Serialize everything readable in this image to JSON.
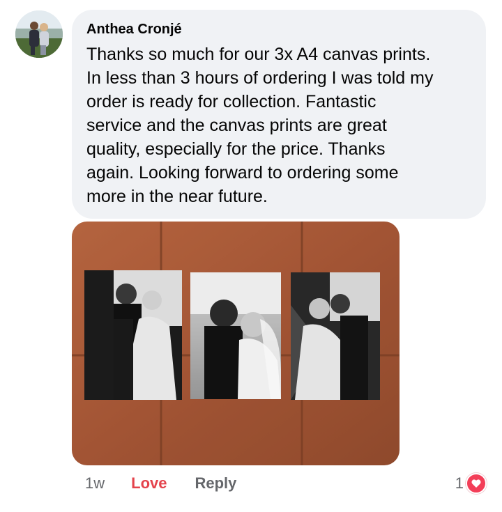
{
  "comment": {
    "author": "Anthea Cronjé",
    "text": "Thanks so much for our 3x A4 canvas prints.\nIn less than 3 hours of ordering I was told my\norder is ready for collection. Fantastic\nservice and the canvas prints are great\nquality, especially for the price. Thanks\nagain. Looking forward to ordering some\nmore in the near future.",
    "timestamp": "1w",
    "love_label": "Love",
    "reply_label": "Reply",
    "reaction_count": "1",
    "reaction_icon": "heart-icon"
  },
  "colors": {
    "bubble": "#f0f2f5",
    "love": "#e4434c",
    "meta": "#65676b",
    "heart": "#f33e58",
    "tile": "#a8542f"
  }
}
